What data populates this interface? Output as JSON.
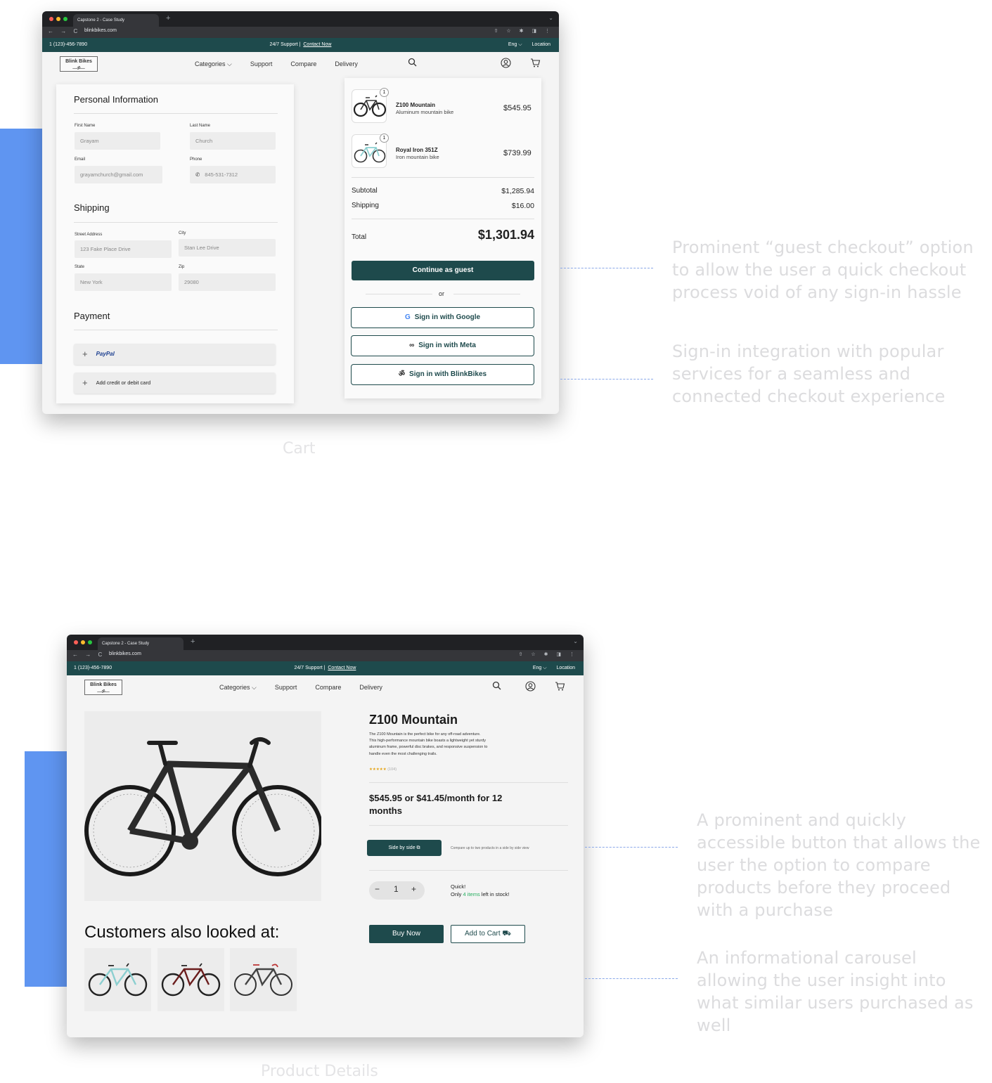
{
  "browser": {
    "tab_title": "Capstone 2 - Case Study",
    "url": "blinkbikes.com",
    "new_tab": "+",
    "menu_chevron": "⌄",
    "nav_arrows": "← → C",
    "addr_icons": "⇧ ☆ ✱ ◨ ⋮"
  },
  "site": {
    "phone": "1 (123)-456-7890",
    "support": "24/7 Support  |",
    "contact": "Contact Now",
    "lang": "Eng ⌵",
    "location": "Location",
    "logo": "Blink Bikes",
    "logo_mark": "—ॐ—",
    "nav": {
      "categories": "Categories ⌵",
      "support": "Support",
      "compare": "Compare",
      "delivery": "Delivery"
    }
  },
  "annotations": {
    "guest": "Prominent “guest checkout” option to allow the user a quick checkout process void of any sign-in hassle",
    "signin": "Sign-in integration with popular services for a seamless and connected checkout experience",
    "compare": "A prominent and quickly accessible button that allows the user the option to compare products before they proceed with a purchase",
    "carousel": "An informational carousel allowing the user insight into what similar users purchased as well"
  },
  "captions": {
    "cart": "Cart",
    "product": "Product Details"
  },
  "cart": {
    "personal_title": "Personal Information",
    "first_name_label": "First Name",
    "first_name": "Grayam",
    "last_name_label": "Last Name",
    "last_name": "Church",
    "email_label": "Email",
    "email": "grayamchurch@gmail.com",
    "phone_label": "Phone",
    "phone": "845-531-7312",
    "shipping_title": "Shipping",
    "street_label": "Street Address",
    "street": "123 Fake Place Drive",
    "city_label": "City",
    "city": "Stan Lee Drive",
    "state_label": "State",
    "state": "New York",
    "zip_label": "Zip",
    "zip": "29080",
    "payment_title": "Payment",
    "paypal": "PayPal",
    "card": "Add credit or debit card",
    "items": [
      {
        "qty": "1",
        "name": "Z100 Mountain",
        "desc": "Aluminum mountain bike",
        "price": "$545.95"
      },
      {
        "qty": "1",
        "name": "Royal Iron 351Z",
        "desc": "Iron mountain bike",
        "price": "$739.99"
      }
    ],
    "subtotal_label": "Subtotal",
    "subtotal": "$1,285.94",
    "shipping_label": "Shipping",
    "shipping": "$16.00",
    "total_label": "Total",
    "total": "$1,301.94",
    "guest_btn": "Continue as guest",
    "or": "or",
    "google_btn": "Sign in with Google",
    "meta_btn": "Sign in with Meta",
    "blink_btn": "Sign in with BlinkBikes"
  },
  "product": {
    "title": "Z100 Mountain",
    "description": "The Z100 Mountain is the perfect bike for any off-road adventure. This high-performance mountain bike boasts a lightweight yet sturdy aluminum frame, powerful disc brakes, and responsive suspension to handle even the most challenging trails.",
    "stars": "★★★★★",
    "reviews": "(104)",
    "rating": 5,
    "price": "$545.95 or $41.45/month for 12 months",
    "compare_btn": "Side by side",
    "compare_note": "Compare up to two products in a side by side view",
    "qty": "1",
    "stock_line1": "Quick!",
    "stock_pre": "Only",
    "stock_count": "4 items",
    "stock_post": "left in stock!",
    "buy_btn": "Buy Now",
    "cart_btn": "Add to Cart",
    "also_title": "Customers also looked at:"
  },
  "colors": {
    "brand": "#1e4a4c",
    "accent_block": "#5f95f1",
    "stock_green": "#27ae60",
    "star": "#e5a416"
  },
  "icons": [
    "search-icon",
    "account-icon",
    "cart-icon",
    "plus-icon",
    "phone-icon",
    "google-icon",
    "meta-icon",
    "bike-icon",
    "compare-icon"
  ]
}
